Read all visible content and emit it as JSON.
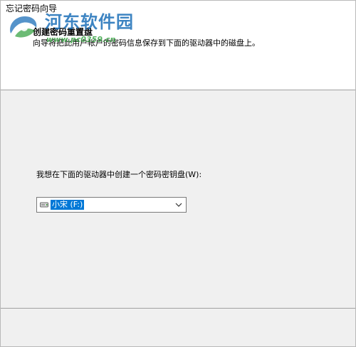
{
  "window": {
    "title": "忘记密码向导"
  },
  "header": {
    "title": "创建密码重置盘",
    "description": "向导将把此用户帐户的密码信息保存到下面的驱动器中的磁盘上。"
  },
  "body": {
    "drive_label": "我想在下面的驱动器中创建一个密码密钥盘(W):",
    "drive_select": {
      "value": "小宋 (F:)",
      "icon": "drive-icon"
    }
  },
  "watermark": {
    "title": "河东软件园",
    "url": "www.pc0359.cn"
  },
  "colors": {
    "selection": "#0078d7",
    "watermark_blue": "#1c6fb8",
    "watermark_green": "#2e9e3a",
    "background": "#f0f0f0",
    "header_bg": "#ffffff"
  }
}
